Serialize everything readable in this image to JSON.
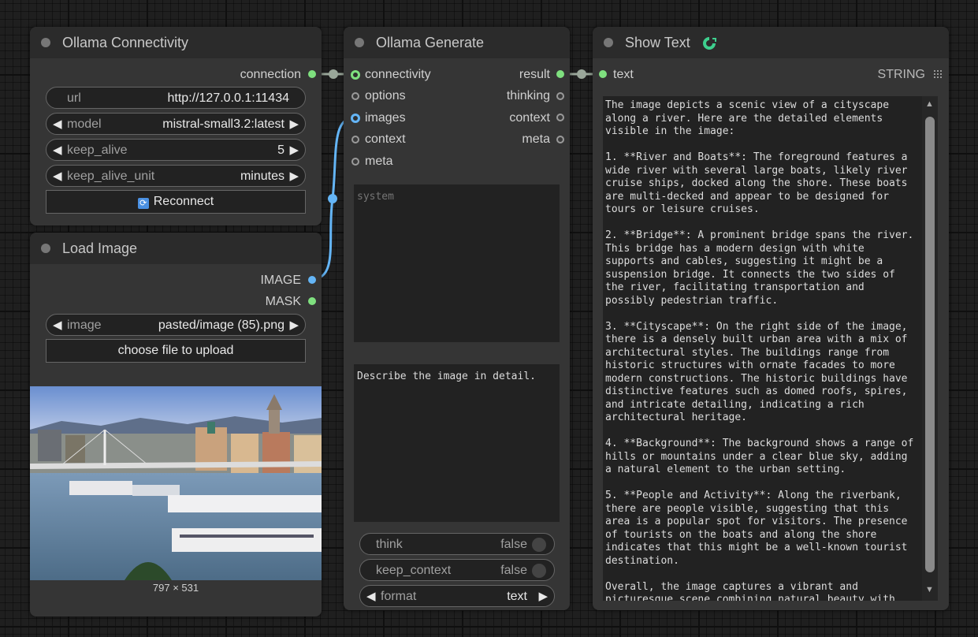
{
  "connectivity_node": {
    "title": "Ollama Connectivity",
    "output_connection": "connection",
    "url_label": "url",
    "url_value": "http://127.0.0.1:11434",
    "model_label": "model",
    "model_value": "mistral-small3.2:latest",
    "keep_alive_label": "keep_alive",
    "keep_alive_value": "5",
    "keep_alive_unit_label": "keep_alive_unit",
    "keep_alive_unit_value": "minutes",
    "reconnect_label": "Reconnect"
  },
  "load_image_node": {
    "title": "Load Image",
    "output_image": "IMAGE",
    "output_mask": "MASK",
    "image_label": "image",
    "image_value": "pasted/image (85).png",
    "upload_label": "choose file to upload",
    "dimensions": "797 × 531"
  },
  "generate_node": {
    "title": "Ollama Generate",
    "inputs": [
      "connectivity",
      "options",
      "images",
      "context",
      "meta"
    ],
    "outputs": [
      "result",
      "thinking",
      "context",
      "meta"
    ],
    "system_placeholder": "system",
    "prompt_value": "Describe the image in detail.",
    "think_label": "think",
    "think_value": "false",
    "keep_context_label": "keep_context",
    "keep_context_value": "false",
    "format_label": "format",
    "format_value": "text"
  },
  "show_text_node": {
    "title": "Show Text",
    "input_text": "text",
    "type_label": "STRING",
    "text": "The image depicts a scenic view of a cityscape along a river. Here are the detailed elements visible in the image:\n\n1. **River and Boats**: The foreground features a wide river with several large boats, likely river cruise ships, docked along the shore. These boats are multi-decked and appear to be designed for tours or leisure cruises.\n\n2. **Bridge**: A prominent bridge spans the river. This bridge has a modern design with white supports and cables, suggesting it might be a suspension bridge. It connects the two sides of the river, facilitating transportation and possibly pedestrian traffic.\n\n3. **Cityscape**: On the right side of the image, there is a densely built urban area with a mix of architectural styles. The buildings range from historic structures with ornate facades to more modern constructions. The historic buildings have distinctive features such as domed roofs, spires, and intricate detailing, indicating a rich architectural heritage.\n\n4. **Background**: The background shows a range of hills or mountains under a clear blue sky, adding a natural element to the urban setting.\n\n5. **People and Activity**: Along the riverbank, there are people visible, suggesting that this area is a popular spot for visitors. The presence of tourists on the boats and along the shore indicates that this might be a well-known tourist destination.\n\nOverall, the image captures a vibrant and picturesque scene combining natural beauty with urban charm."
  },
  "colors": {
    "connection_green": "#7fe07f",
    "image_blue": "#64b5f6",
    "node_bg": "#353535",
    "header_bg": "#2b2b2b"
  }
}
